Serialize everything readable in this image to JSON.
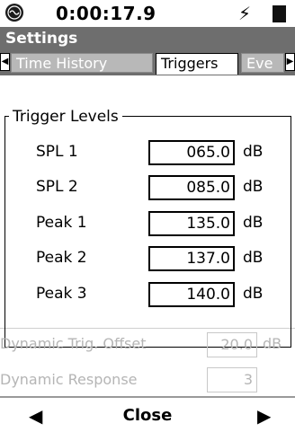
{
  "status": {
    "time": "0:00:17.9",
    "power_icon": "lightning-bolt-icon",
    "battery_icon": "battery-icon",
    "logo_icon": "device-logo-icon"
  },
  "header": {
    "title": "Settings"
  },
  "tabs": {
    "left_arrow": "◀",
    "right_arrow": "▶",
    "items": [
      {
        "label": "Time History",
        "active": false
      },
      {
        "label": "Triggers",
        "active": true
      },
      {
        "label": "Eve",
        "active": false
      }
    ]
  },
  "trigger_levels": {
    "title": "Trigger Levels",
    "rows": [
      {
        "label": "SPL 1",
        "value": "065.0",
        "unit": "dB"
      },
      {
        "label": "SPL 2",
        "value": "085.0",
        "unit": "dB"
      },
      {
        "label": "Peak 1",
        "value": "135.0",
        "unit": "dB"
      },
      {
        "label": "Peak 2",
        "value": "137.0",
        "unit": "dB"
      },
      {
        "label": "Peak 3",
        "value": "140.0",
        "unit": "dB"
      }
    ]
  },
  "dynamic": {
    "offset_label": "Dynamic Trig. Offset",
    "offset_value": "20.0",
    "offset_unit": "dB",
    "response_label": "Dynamic Response",
    "response_value": "3"
  },
  "bottom": {
    "left_arrow": "◀",
    "close_label": "Close",
    "right_arrow": "▶"
  }
}
